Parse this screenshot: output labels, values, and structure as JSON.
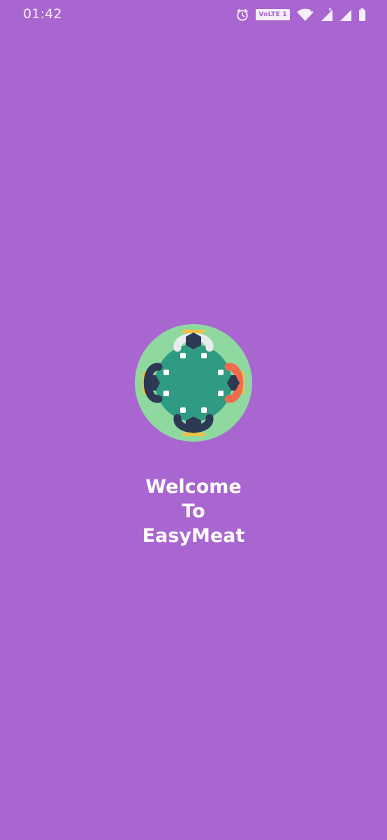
{
  "status_bar": {
    "time": "01:42",
    "network_badge": "VoLTE 1",
    "icons": [
      "alarm-icon",
      "volte-icon",
      "wifi-icon",
      "signal-icon",
      "signal-icon-2",
      "battery-icon"
    ]
  },
  "splash": {
    "logo_icon": "meeting-table-logo-icon",
    "title_lines": [
      "Welcome",
      "To",
      "EasyMeat"
    ]
  },
  "colors": {
    "background": "#a966d0",
    "logo_outer": "#8fd9a0",
    "logo_table": "#2f9b83",
    "person_dark": "#2d3852",
    "person_orange": "#f26b4e",
    "person_white": "#e9ecef",
    "chair": "#f3c042"
  }
}
